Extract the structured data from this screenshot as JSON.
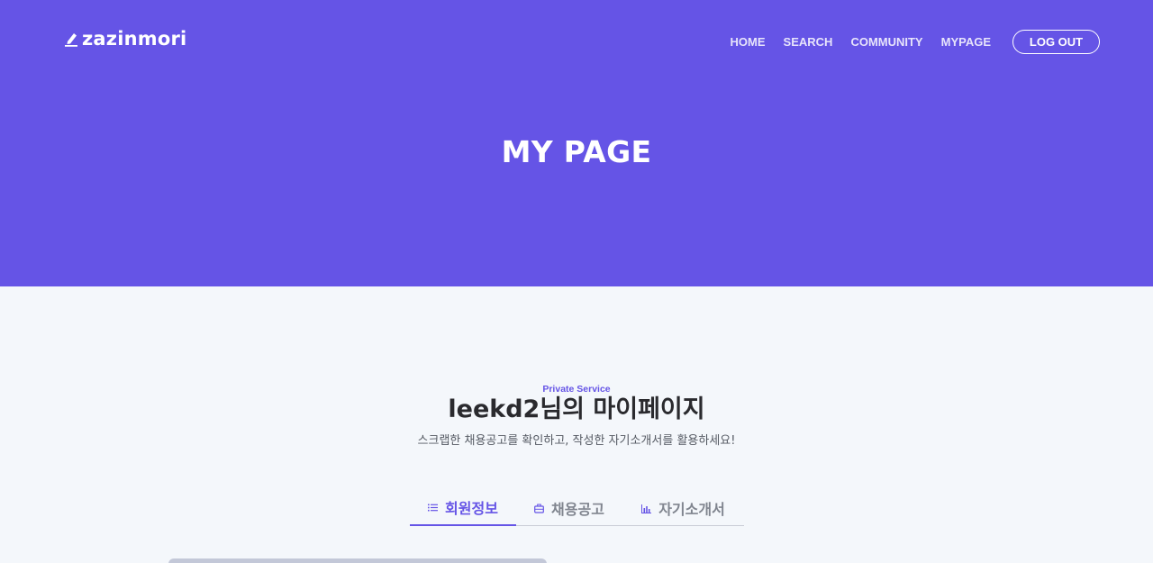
{
  "header": {
    "brand": "zazinmori",
    "brand_icon": "pencil-icon",
    "nav": [
      "HOME",
      "SEARCH",
      "COMMUNITY",
      "MYPAGE"
    ],
    "logout_label": "LOG OUT"
  },
  "hero": {
    "title": "MY PAGE"
  },
  "intro": {
    "eyebrow": "Private Service",
    "greeting": "leekd2님의 마이페이지",
    "subtitle": "스크랩한 채용공고를 확인하고, 작성한 자기소개서를 활용하세요!"
  },
  "tabs": [
    {
      "label": "회원정보",
      "icon": "list-icon",
      "active": true
    },
    {
      "label": "채용공고",
      "icon": "briefcase-icon",
      "active": false
    },
    {
      "label": "자기소개서",
      "icon": "bar-chart-icon",
      "active": false
    }
  ],
  "colors": {
    "primary": "#6554e6",
    "page_bg": "#f4f7fb",
    "text_dark": "#2a2a2e",
    "text_muted": "#80858f"
  }
}
